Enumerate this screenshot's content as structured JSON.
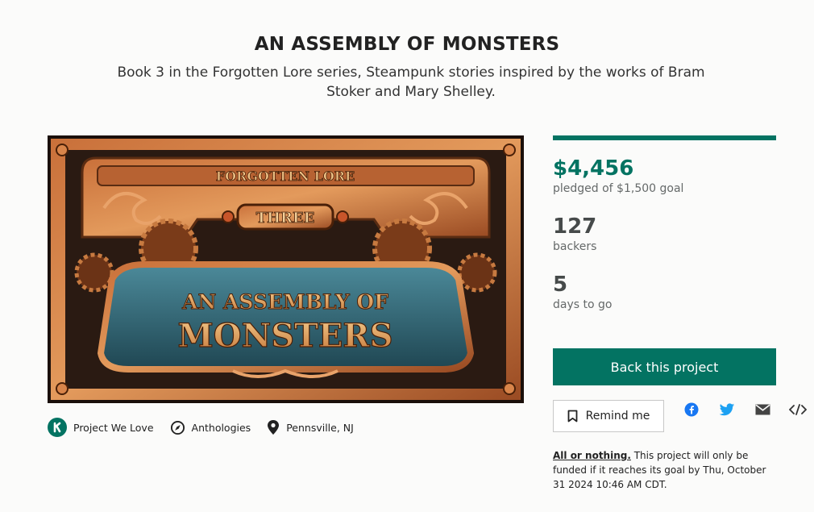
{
  "project": {
    "title": "AN ASSEMBLY OF MONSTERS",
    "subtitle": "Book 3 in the Forgotten Lore series, Steampunk stories inspired by the works of Bram Stoker and Mary Shelley."
  },
  "hero": {
    "banner_top": "FORGOTTEN LORE",
    "banner_plate": "THREE",
    "banner_line1": "AN ASSEMBLY OF",
    "banner_line2": "MONSTERS"
  },
  "meta": {
    "pwl_label": "Project We Love",
    "category_label": "Anthologies",
    "location_label": "Pennsville, NJ"
  },
  "funding": {
    "progress_fraction": 1.0,
    "pledged_amount": "$4,456",
    "pledged_label": "pledged of $1,500 goal",
    "backers_count": "127",
    "backers_label": "backers",
    "days_count": "5",
    "days_label": "days to go"
  },
  "actions": {
    "back_label": "Back this project",
    "remind_label": "Remind me"
  },
  "share_icons": [
    "facebook-icon",
    "twitter-icon",
    "email-icon",
    "embed-icon"
  ],
  "notice": {
    "strong": "All or nothing.",
    "text": " This project will only be funded if it reaches its goal by Thu, October 31 2024 10:46 AM CDT."
  },
  "colors": {
    "accent": "#037362",
    "stat_value": "#464a4a"
  }
}
